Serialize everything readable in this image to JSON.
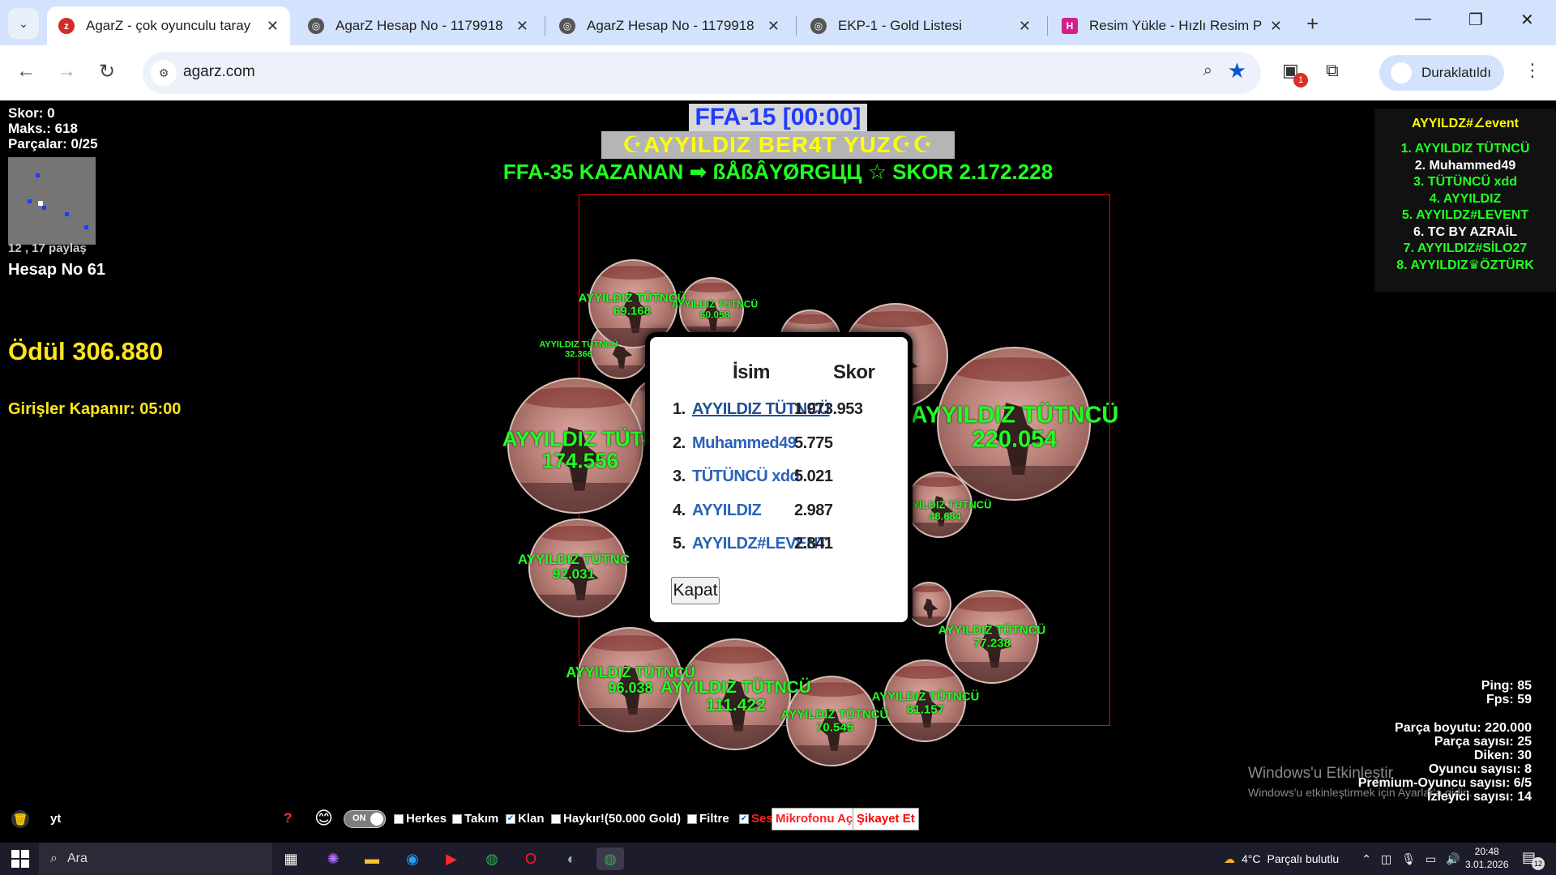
{
  "browser": {
    "tabs": [
      {
        "title": "AgarZ - çok oyunculu taray",
        "favicon": "agarz-icon",
        "active": true
      },
      {
        "title": "AgarZ Hesap No - 1179918",
        "favicon": "globe-icon"
      },
      {
        "title": "AgarZ Hesap No - 1179918",
        "favicon": "globe-icon"
      },
      {
        "title": "EKP-1 - Gold Listesi",
        "favicon": "globe-icon"
      },
      {
        "title": "Resim Yükle - Hızlı Resim P",
        "favicon": "hizli-resim-icon"
      }
    ],
    "address": "agarz.com",
    "profile_label": "Duraklatıldı",
    "extension_badge": "1"
  },
  "hud": {
    "skor": "Skor: 0",
    "maks": "Maks.: 618",
    "parcalar": "Parçalar: 0/25",
    "coords": "12 , 17 paylaş",
    "hesap": "Hesap No 61",
    "odul": "Ödül 306.880",
    "girisler": "Girişler Kapanır: 05:00"
  },
  "banner": {
    "line1": "FFA-15 [00:00]",
    "line2": "☪AYYILDIZ BER4T YUZ☪☪",
    "line3": "FFA-35 KAZANAN ➡ ßÅßÂYØRGЦЦ ☆ SKOR 2.172.228"
  },
  "leaderboard": {
    "title": "AYYILDZ#∠event",
    "items": [
      {
        "text": "1. AYYILDIZ TÜTNCÜ",
        "color": "#22ff22"
      },
      {
        "text": "2. Muhammed49",
        "color": "#ffffff"
      },
      {
        "text": "3. TÜTÜNCÜ xdd",
        "color": "#22ff22"
      },
      {
        "text": "4. AYYILDIZ",
        "color": "#22ff22"
      },
      {
        "text": "5. AYYILDZ#LEVENT",
        "color": "#22ff22"
      },
      {
        "text": "6. TC BY AZRAİL",
        "color": "#ffffff"
      },
      {
        "text": "7. AYYILDIZ#SİLO27",
        "color": "#22ff22"
      },
      {
        "text": "8. AYYILDIZ♛ÖZTÜRK",
        "color": "#22ff22"
      }
    ]
  },
  "cells": [
    {
      "name": "AYYILDIZ TÜTNCÜ",
      "score": "69.168"
    },
    {
      "name": "AYYILDIZ TÜTNCÜ",
      "score": "60.058"
    },
    {
      "name": "AYYILDIZ TÜTNCÜ",
      "score": "32.366"
    },
    {
      "name": "AYYILDIZ TÜTNCÜ",
      "score": "220.054"
    },
    {
      "name": "AYYILDIZ TÜTN",
      "score": "174.556"
    },
    {
      "name": "AYYILDIZ TÜTNC",
      "score": "92.031"
    },
    {
      "name": "AYYILDIZ TÜTNCÜ",
      "score": "96.038"
    },
    {
      "name": "AYYILDIZ TÜTNCÜ",
      "score": "111.422"
    },
    {
      "name": "AYYILDIZ TÜTNCÜ",
      "score": "70.545"
    },
    {
      "name": "AYYILDIZ TÜTNCÜ",
      "score": "81.157"
    },
    {
      "name": "AYYILDIZ TÜTNCÜ",
      "score": "77.238"
    },
    {
      "name": "AYYILDIZ TÜTNCÜ",
      "score": "48.684"
    }
  ],
  "modal": {
    "col_name": "İsim",
    "col_score": "Skor",
    "rows": [
      {
        "rank": "1.",
        "name": "AYYILDIZ TÜTNCÜ",
        "score": "1.973.953"
      },
      {
        "rank": "2.",
        "name": "Muhammed49",
        "score": "5.775"
      },
      {
        "rank": "3.",
        "name": "TÜTÜNCÜ xdd",
        "score": "5.021"
      },
      {
        "rank": "4.",
        "name": "AYYILDIZ",
        "score": "2.987"
      },
      {
        "rank": "5.",
        "name": "AYYILDZ#LEVENT",
        "score": "2.841"
      }
    ],
    "close_label": "Kapat"
  },
  "stats": {
    "ping": "Ping: 85",
    "fps": "Fps: 59",
    "parca_boyutu": "Parça boyutu: 220.000",
    "parca_sayisi": "Parça sayısı: 25",
    "diken": "Diken: 30",
    "oyuncu": "Oyuncu sayısı: 8",
    "premium": "Premium-Oyuncu sayısı: 6/5",
    "izleyici": "İzleyici sayısı: 14"
  },
  "windows_activation": {
    "line1": "Windows'u Etkinleştir",
    "line2": "Windows'u etkinleştirmek için Ayarlar'a gidin."
  },
  "gamebar": {
    "chat_value": "yt",
    "help": "?",
    "toggle_label": "ON",
    "herkes": "Herkes",
    "takim": "Takım",
    "klan": "Klan",
    "haykir": "Haykır!(50.000 Gold)",
    "filtre": "Filtre",
    "ses": "Ses",
    "mikrofon": "Mikrofonu Aç",
    "sikayet": "Şikayet Et"
  },
  "taskbar": {
    "search": "Ara",
    "weather_temp": "4°C",
    "weather_text": "Parçalı bulutlu",
    "time": "20:48",
    "date": "3.01.2026",
    "notif_count": "12"
  }
}
